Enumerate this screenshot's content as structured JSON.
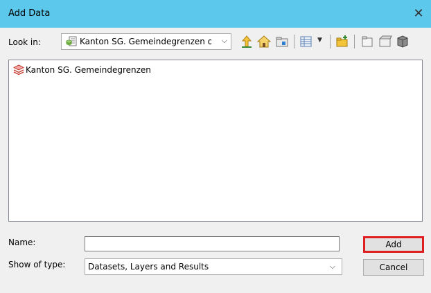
{
  "window": {
    "title": "Add Data",
    "close_glyph": "✕"
  },
  "lookin": {
    "label": "Look in:",
    "value": "Kanton SG. Gemeindegrenzen o",
    "icon": "geodatabase-icon",
    "chevron": "⌵"
  },
  "toolbar": {
    "icons": [
      "up-one-level-icon",
      "home-icon",
      "connect-folder-icon",
      "view-options-icon",
      "dropdown-arrow-icon",
      "new-folder-icon",
      "catalog-icon",
      "toolbox-icon",
      "database-icon"
    ]
  },
  "file_list": {
    "items": [
      {
        "label": "Kanton SG. Gemeindegrenzen",
        "icon": "layer-icon"
      }
    ]
  },
  "name": {
    "label": "Name:",
    "value": "",
    "placeholder": ""
  },
  "type": {
    "label": "Show of type:",
    "value": "Datasets, Layers and Results",
    "chevron": "⌵"
  },
  "buttons": {
    "add": "Add",
    "cancel": "Cancel"
  },
  "colors": {
    "titlebar": "#5bc8ec",
    "highlight": "#e02020"
  }
}
